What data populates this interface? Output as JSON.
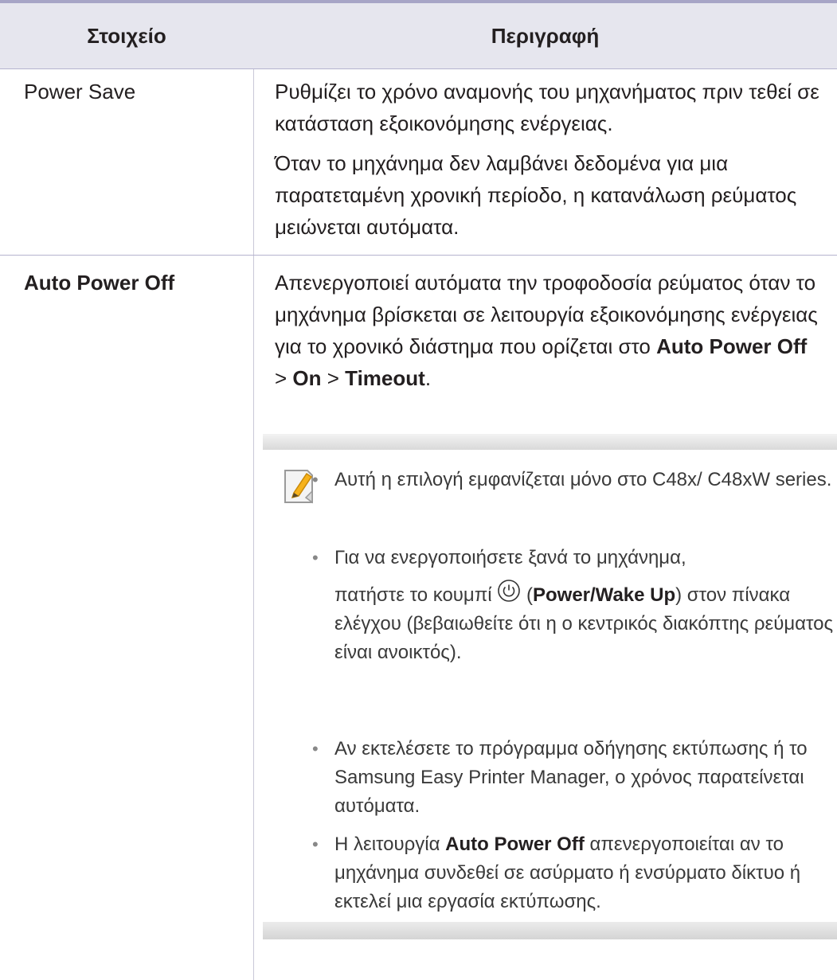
{
  "table": {
    "header": {
      "col1": "Στοιχείο",
      "col2": "Περιγραφή"
    },
    "row1": {
      "item": "Power Save",
      "desc1": "Ρυθμίζει το χρόνο αναμονής του μηχανήματος πριν τεθεί σε κατάσταση εξοικονόμησης ενέργειας.",
      "desc2": "Όταν το μηχάνημα δεν λαμβάνει δεδομένα για μια παρατεταμένη χρονική περίοδο, η κατανάλωση ρεύματος μειώνεται αυτόματα."
    },
    "row2": {
      "item": "Auto Power Off",
      "desc_pre": "Απενεργοποιεί αυτόματα την τροφοδοσία ρεύματος όταν το μηχάνημα βρίσκεται σε λειτουργία εξοικονόμησης ενέργειας για το χρονικό διάστημα που ορίζεται στο ",
      "path_a": "Auto Power Off",
      "sep1": " > ",
      "path_b": "On",
      "sep2": " > ",
      "path_c": "Timeout",
      "end": "."
    }
  },
  "note": {
    "icon": "note-pencil-icon",
    "bullet": "•",
    "item1": "Αυτή η επιλογή εμφανίζεται μόνο στο C48x/ C48xW series.",
    "item2": {
      "line1": "Για να ενεργοποιήσετε ξανά το μηχάνημα,",
      "pre": "πατήστε το κουμπί ",
      "icon": "power-icon",
      "open": " (",
      "bold": "Power/Wake Up",
      "close": ")",
      "rest": " στον πίνακα ελέγχου (βεβαιωθείτε ότι η ο κεντρικός διακόπτης ρεύματος είναι ανοικτός)."
    },
    "item3": "Αν εκτελέσετε το πρόγραμμα οδήγησης εκτύπωσης ή το Samsung Easy Printer Manager, ο χρόνος παρατείνεται αυτόματα.",
    "item4": {
      "pre": "Η λειτουργία ",
      "bold": "Auto Power Off",
      "rest": " απενεργοποιείται αν το μηχάνημα συνδεθεί σε ασύρματο ή ενσύρματο δίκτυο ή εκτελεί μια εργασία εκτύπωσης."
    }
  },
  "colors": {
    "header_bg": "#e6e6ee",
    "rule": "#a7a5c6"
  }
}
